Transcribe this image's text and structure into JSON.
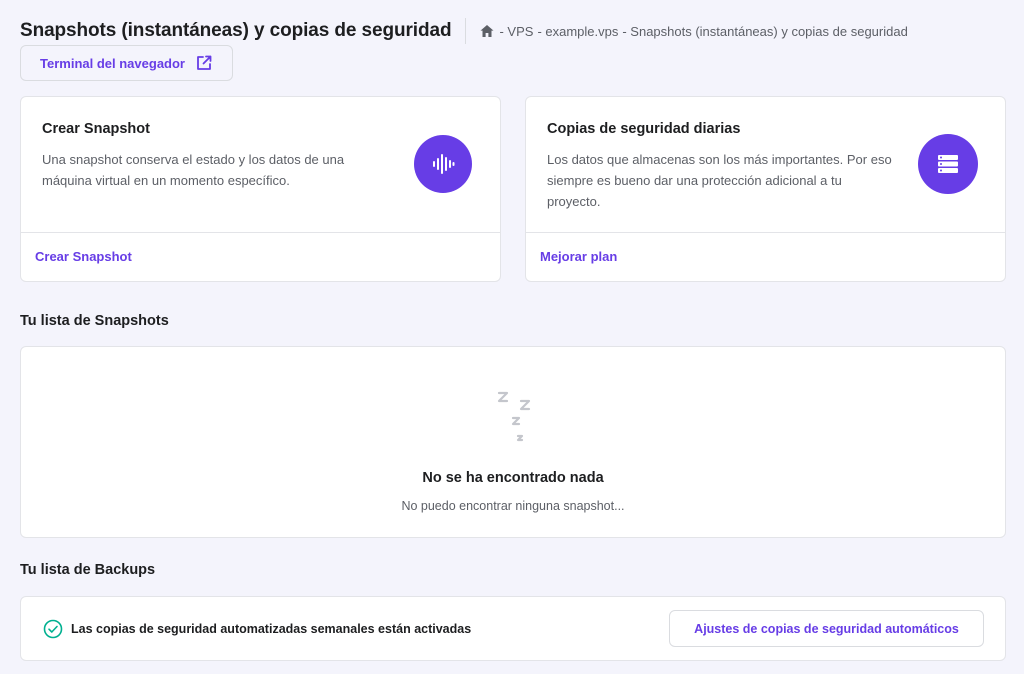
{
  "header": {
    "title": "Snapshots (instantáneas) y copias de seguridad",
    "breadcrumb": [
      "- VPS",
      "- example.vps",
      "- Snapshots (instantáneas) y copias de seguridad"
    ]
  },
  "terminal_button": {
    "label": "Terminal del navegador"
  },
  "snapshot_card": {
    "title": "Crear Snapshot",
    "description": "Una snapshot conserva el estado y los datos de una máquina virtual en un momento específico.",
    "link": "Crear Snapshot"
  },
  "backup_card": {
    "title": "Copias de seguridad diarias",
    "description": "Los datos que almacenas son los más importantes. Por eso siempre es bueno dar una protección adicional a tu proyecto.",
    "link": "Mejorar plan"
  },
  "snapshots_section": {
    "title": "Tu lista de Snapshots",
    "empty_title": "No se ha encontrado nada",
    "empty_subtitle": "No puedo encontrar ninguna snapshot..."
  },
  "backups_section": {
    "title": "Tu lista de Backups",
    "status_text": "Las copias de seguridad automatizadas semanales están activadas",
    "settings_button": "Ajustes de copias de seguridad automáticos"
  },
  "colors": {
    "accent": "#673de6",
    "success": "#00b090",
    "background": "#f4f4fc"
  },
  "icons": [
    "home-icon",
    "external-link-icon",
    "audio-wave-icon",
    "server-icon",
    "sleeping-zzz-icon",
    "check-circle-icon"
  ]
}
